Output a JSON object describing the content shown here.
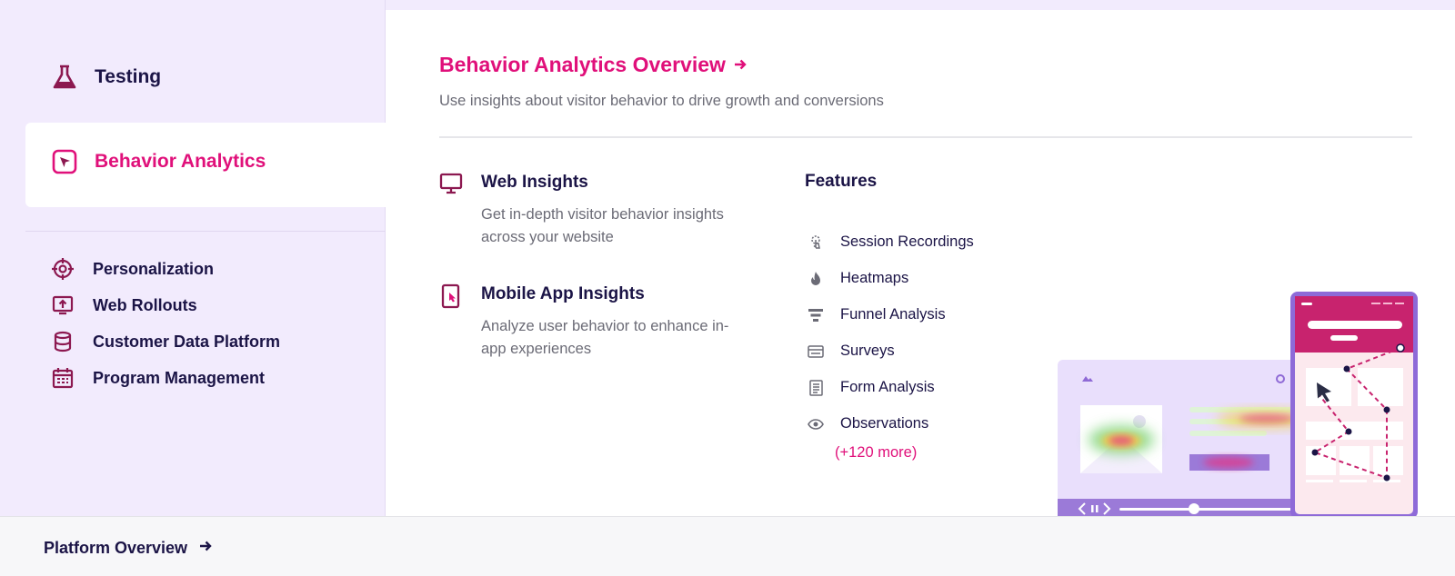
{
  "sidebar": {
    "primary": [
      {
        "label": "Testing",
        "icon": "flask-icon"
      },
      {
        "label": "Behavior Analytics",
        "icon": "cursor-click-icon",
        "active": true
      }
    ],
    "secondary": [
      {
        "label": "Personalization",
        "icon": "target-icon"
      },
      {
        "label": "Web Rollouts",
        "icon": "upload-monitor-icon"
      },
      {
        "label": "Customer Data Platform",
        "icon": "database-icon"
      },
      {
        "label": "Program Management",
        "icon": "calendar-icon"
      }
    ]
  },
  "main": {
    "overview_title": "Behavior Analytics Overview",
    "overview_subtitle": "Use insights about visitor behavior to drive growth and conversions",
    "products": [
      {
        "title": "Web Insights",
        "desc": "Get in-depth visitor behavior insights across your website",
        "icon": "monitor-icon"
      },
      {
        "title": "Mobile App Insights",
        "desc": "Analyze user behavior to enhance in-app experiences",
        "icon": "mobile-tap-icon"
      }
    ],
    "features_title": "Features",
    "features": [
      {
        "label": "Session Recordings",
        "icon": "tap-gesture-icon"
      },
      {
        "label": "Heatmaps",
        "icon": "flame-icon"
      },
      {
        "label": "Funnel Analysis",
        "icon": "funnel-icon"
      },
      {
        "label": "Surveys",
        "icon": "survey-card-icon"
      },
      {
        "label": "Form Analysis",
        "icon": "form-icon"
      },
      {
        "label": "Observations",
        "icon": "eye-icon"
      }
    ],
    "more_link": "(+120 more)"
  },
  "footer": {
    "link": "Platform Overview"
  },
  "colors": {
    "accent": "#e0107a",
    "brand_dark": "#1b1446",
    "icon_maroon": "#8c1850",
    "sidebar_bg": "#f2ebfd",
    "illus_purple": "#9b7ad8",
    "illus_magenta": "#c8236e"
  }
}
